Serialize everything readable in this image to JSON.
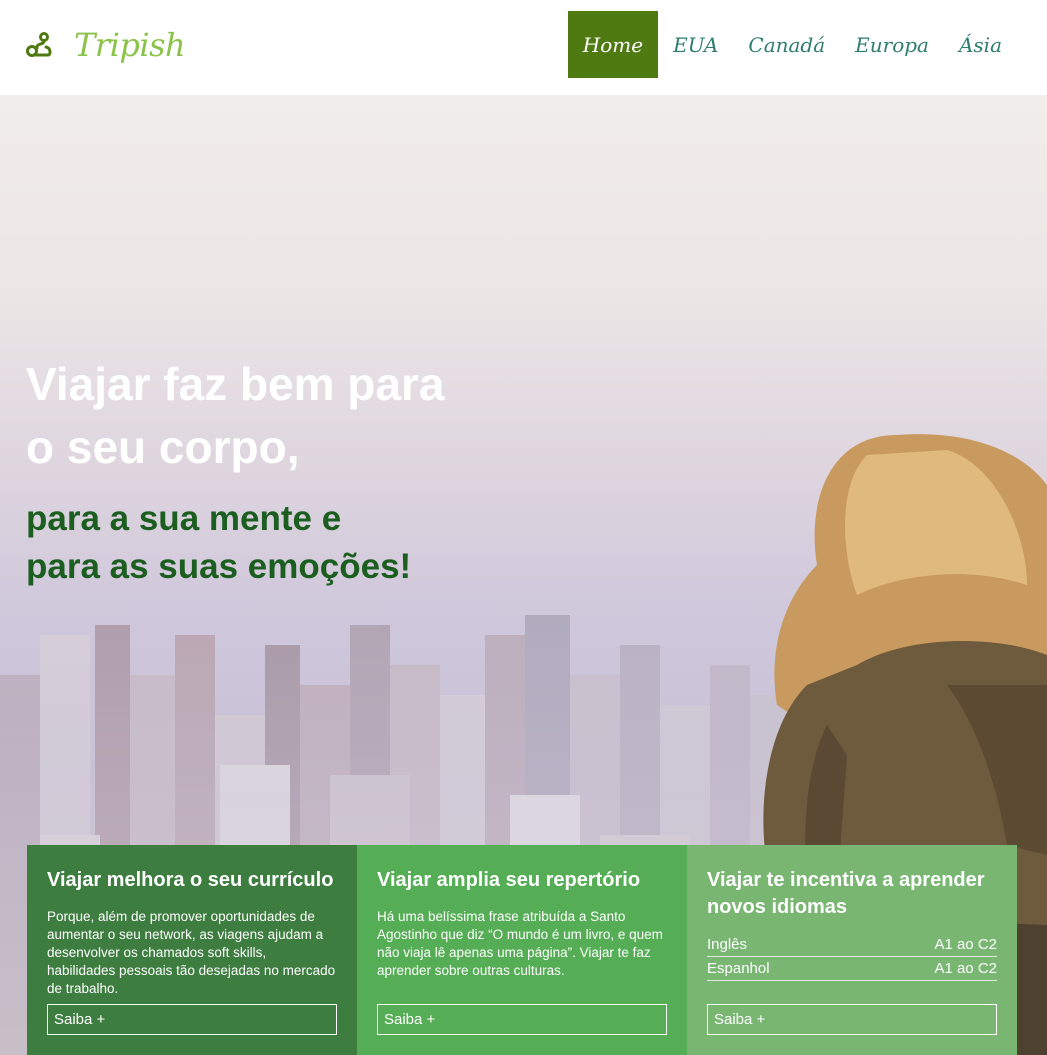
{
  "brand": {
    "name": "Tripish",
    "icon": "route-icon",
    "color": "#8bc34a"
  },
  "nav": {
    "items": [
      {
        "label": "Home",
        "active": true
      },
      {
        "label": "EUA",
        "active": false
      },
      {
        "label": "Canadá",
        "active": false
      },
      {
        "label": "Europa",
        "active": false
      },
      {
        "label": "Ásia",
        "active": false
      }
    ],
    "active_color": "#4f7a12"
  },
  "hero": {
    "headline": [
      "Viajar faz bem para",
      "o seu corpo,"
    ],
    "subheadline": [
      "para a sua mente e",
      "para as suas emoções!"
    ]
  },
  "cards": [
    {
      "title": "Viajar melhora o seu currículo",
      "text": "Porque, além de promover oportunidades de aumentar o seu network, as viagens ajudam a desenvolver os chamados soft skills, habilidades pessoais tão desejadas no mercado de trabalho.",
      "button": "Saiba +",
      "color": "#3d7d3f"
    },
    {
      "title": "Viajar amplia seu repertório",
      "text": "Há uma belíssima frase atribuída a Santo Agostinho que diz “O mundo é um livro, e quem não viaja lê apenas uma página”. Viajar te faz aprender sobre outras culturas.",
      "button": "Saiba +",
      "color": "#55ad55"
    },
    {
      "title": "Viajar te incentiva a aprender novos idiomas",
      "languages": [
        {
          "name": "Inglês",
          "level": "A1 ao C2"
        },
        {
          "name": "Espanhol",
          "level": "A1 ao C2"
        }
      ],
      "button": "Saiba +",
      "color": "#78b672"
    }
  ]
}
